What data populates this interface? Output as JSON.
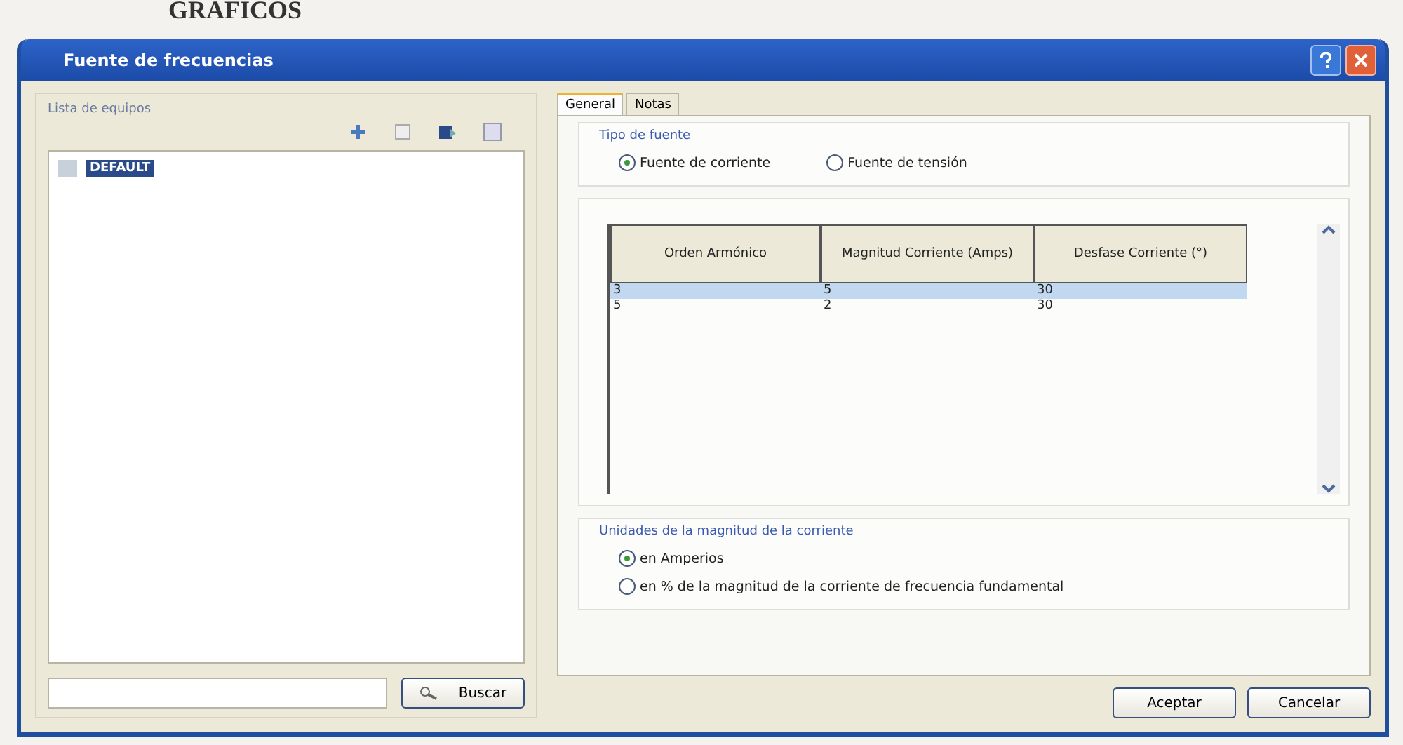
{
  "page_heading": "GRAFICOS",
  "window": {
    "title": "Fuente de frecuencias"
  },
  "equipment_list": {
    "label": "Lista de equipos",
    "items": [
      {
        "label": "DEFAULT",
        "selected": true
      }
    ],
    "search_button": "Buscar"
  },
  "tabs": [
    {
      "label": "General",
      "selected": true
    },
    {
      "label": "Notas",
      "selected": false
    }
  ],
  "source_type": {
    "label": "Tipo de fuente",
    "options": [
      {
        "label": "Fuente de corriente",
        "selected": true
      },
      {
        "label": "Fuente de tensión",
        "selected": false
      }
    ]
  },
  "table": {
    "columns": [
      "Orden Armónico",
      "Magnitud Corriente (Amps)",
      "Desfase Corriente (°)"
    ],
    "rows": [
      {
        "cells": [
          "3",
          "5",
          "30"
        ],
        "selected": true
      },
      {
        "cells": [
          "5",
          "2",
          "30"
        ],
        "selected": false
      }
    ]
  },
  "units": {
    "label": "Unidades de la magnitud de la corriente",
    "options": [
      {
        "label": "en Amperios",
        "selected": true
      },
      {
        "label": "en % de la magnitud de la corriente de frecuencia fundamental",
        "selected": false
      }
    ]
  },
  "buttons": [
    "Aceptar",
    "Cancelar"
  ]
}
